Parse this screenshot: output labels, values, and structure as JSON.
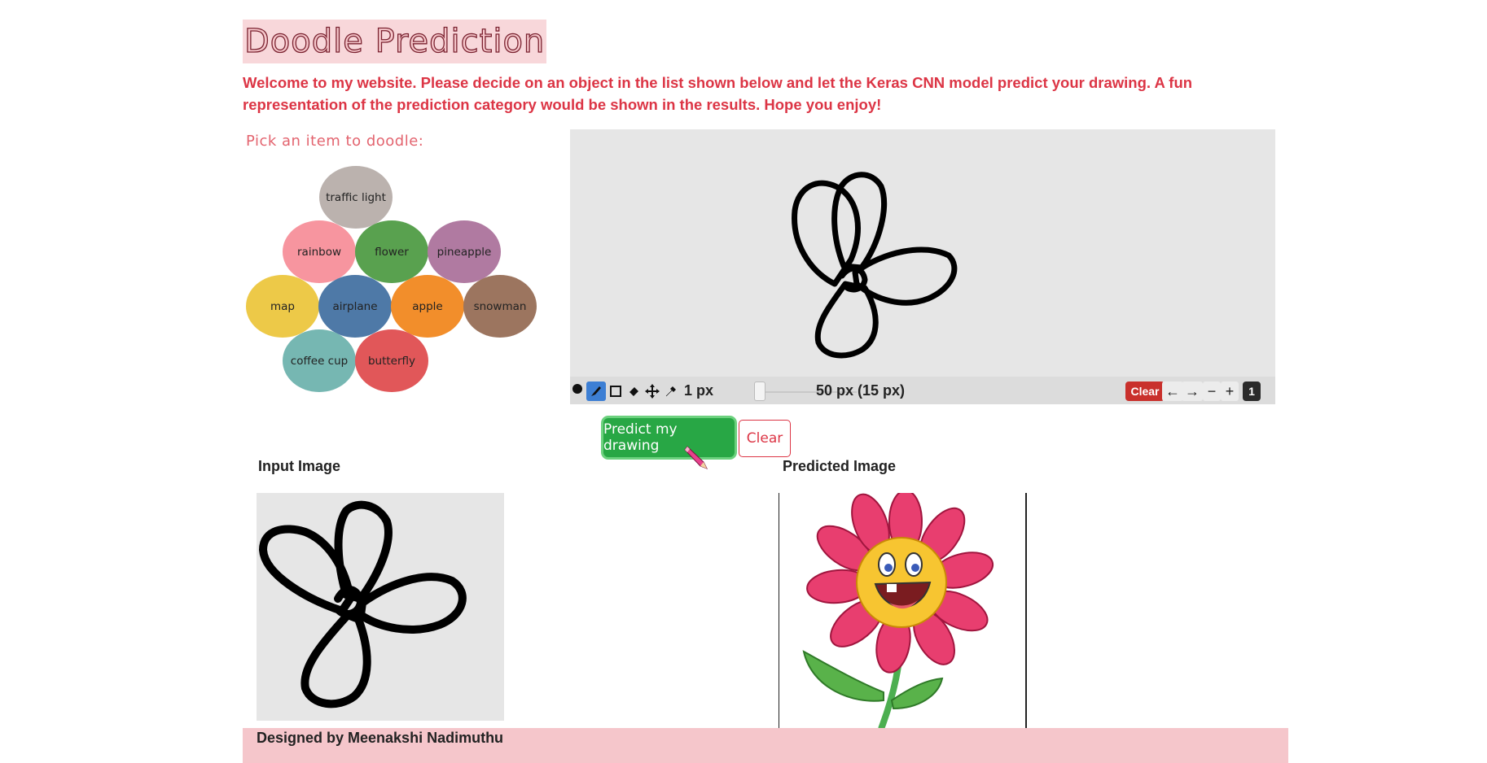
{
  "header": {
    "title": "Doodle Prediction",
    "welcome": "Welcome to my website. Please decide on an object in the list shown below and let the Keras CNN model predict your drawing. A fun representation of the prediction category would be shown in the results. Hope you enjoy!"
  },
  "picker": {
    "label": "Pick an item to doodle:",
    "items": [
      {
        "label": "traffic light",
        "color": "#bbb2ae"
      },
      {
        "label": "rainbow",
        "color": "#f7959f"
      },
      {
        "label": "flower",
        "color": "#59a14f"
      },
      {
        "label": "pineapple",
        "color": "#b07aa1"
      },
      {
        "label": "map",
        "color": "#edc948"
      },
      {
        "label": "airplane",
        "color": "#4e79a7"
      },
      {
        "label": "apple",
        "color": "#f28e2b"
      },
      {
        "label": "snowman",
        "color": "#9c755f"
      },
      {
        "label": "coffee cup",
        "color": "#76b7b2"
      },
      {
        "label": "butterfly",
        "color": "#e15759"
      }
    ]
  },
  "canvas": {
    "background": "#e6e6e6",
    "toolbar": {
      "tools": [
        "brush-icon",
        "rectangle-icon",
        "eraser-icon",
        "move-icon",
        "eyedropper-icon"
      ],
      "brush_size": "1 px",
      "zoom_size": "50 px (15 px)",
      "clear_label": "Clear",
      "undo_label": "←",
      "redo_label": "→",
      "zoom_out_label": "−",
      "zoom_in_label": "+",
      "page_label": "1"
    }
  },
  "actions": {
    "predict_label": "Predict my drawing",
    "clear_label": "Clear"
  },
  "results": {
    "input_label": "Input Image",
    "predicted_label": "Predicted Image"
  },
  "footer": {
    "credit": "Designed by Meenakshi Nadimuthu"
  },
  "colors": {
    "accent_red": "#dc3545",
    "title_bg": "#f8d7da",
    "footer_bg": "#f5c6cb",
    "predict_green": "#28a745"
  }
}
